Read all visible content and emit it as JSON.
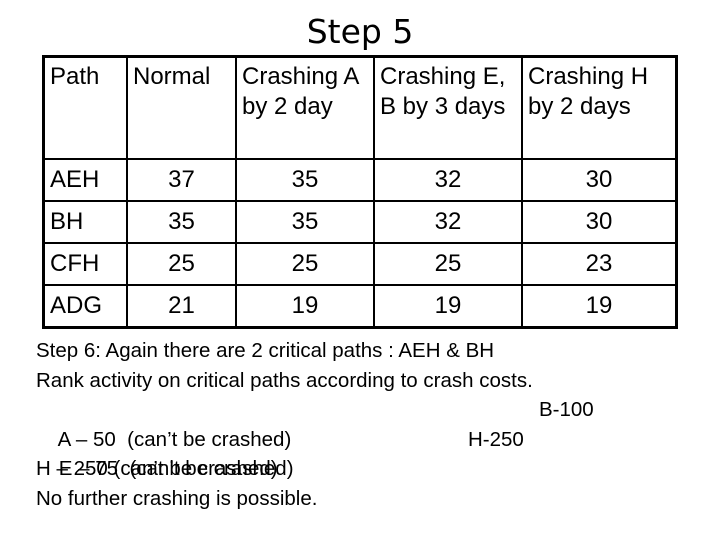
{
  "slide": {
    "title": "Step 5"
  },
  "table": {
    "headers": [
      "Path",
      "Normal",
      "Crashing A by 2 day",
      "Crashing E, B by 3 days",
      "Crashing H by 2 days"
    ],
    "rows": [
      {
        "path": "AEH",
        "normal": "37",
        "crash_a": "35",
        "crash_eb": "32",
        "crash_h": "30"
      },
      {
        "path": "BH",
        "normal": "35",
        "crash_a": "35",
        "crash_eb": "32",
        "crash_h": "30"
      },
      {
        "path": "CFH",
        "normal": "25",
        "crash_a": "25",
        "crash_eb": "25",
        "crash_h": "23"
      },
      {
        "path": "ADG",
        "normal": "21",
        "crash_a": "19",
        "crash_eb": "19",
        "crash_h": "19"
      }
    ]
  },
  "notes": {
    "line1": "Step 6: Again there are 2 critical paths : AEH & BH",
    "line2": "Rank activity on critical paths according to crash costs.",
    "line3_left": "A – 50  (can’t be crashed)",
    "line3_right": "B-100",
    "line4_left": "E – 75  (can’t be crashed)",
    "line4_right": "H-250",
    "line5": "H – 250 (can’t be crashed)",
    "line6": "No further crashing is possible."
  }
}
